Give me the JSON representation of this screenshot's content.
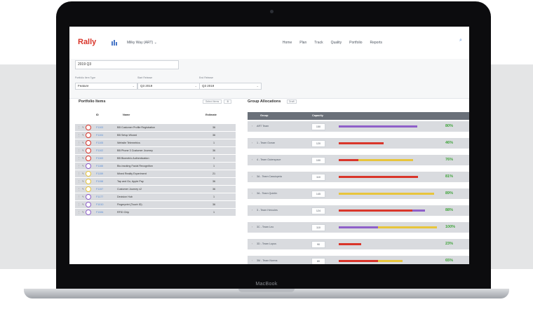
{
  "device": {
    "brand": "MacBook"
  },
  "app": {
    "logo": "Rally",
    "workspace": "Milky Way (ART) ⌄",
    "nav": [
      "Home",
      "Plan",
      "Track",
      "Quality",
      "Portfolio",
      "Reports"
    ]
  },
  "filters": {
    "title": "2019 Q3",
    "item_type_label": "Portfolio Item Type",
    "item_type_value": "Feature",
    "start_label": "Start Release",
    "start_value": "Q3 2019",
    "end_label": "End Release",
    "end_value": "Q3 2019"
  },
  "portfolio": {
    "title": "Portfolio Items",
    "tools": [
      "Select Items",
      "⚙"
    ],
    "columns": {
      "id": "ID",
      "name": "Name",
      "estimate": "Estimate"
    },
    "rows": [
      {
        "id": "F1103",
        "name": "BB Customer Profile Registration",
        "estimate": "36",
        "color": "#d9352a"
      },
      {
        "id": "F1104",
        "name": "BB Setup Wizard",
        "estimate": "36",
        "color": "#d9352a"
      },
      {
        "id": "F1105",
        "name": "Website Telemetrics",
        "estimate": "1",
        "color": "#d9352a"
      },
      {
        "id": "F1102",
        "name": "BB Phone 3 Customer Journey",
        "estimate": "36",
        "color": "#d9352a"
      },
      {
        "id": "F1163",
        "name": "BB Biometric Authentication",
        "estimate": "3",
        "color": "#d9352a"
      },
      {
        "id": "F1166",
        "name": "Bio-tracking Facial Recognition",
        "estimate": "1",
        "color": "#8e5fc9"
      },
      {
        "id": "F1159",
        "name": "Mixed Reality Experiment",
        "estimate": "21",
        "color": "#e8c53c"
      },
      {
        "id": "F1158",
        "name": "Tap and Go, Apple Pay",
        "estimate": "36",
        "color": "#e8c53c"
      },
      {
        "id": "F1157",
        "name": "Customer Journey v2",
        "estimate": "36",
        "color": "#e8c53c"
      },
      {
        "id": "F1177",
        "name": "Decision Hub",
        "estimate": "1",
        "color": "#8e5fc9"
      },
      {
        "id": "F1010",
        "name": "Fingerprint (Touch ID)",
        "estimate": "36",
        "color": "#8e5fc9"
      },
      {
        "id": "F1084",
        "name": "RFID Chip",
        "estimate": "1",
        "color": "#8e5fc9"
      }
    ]
  },
  "allocations": {
    "title": "Group Allocations",
    "badge": "Draft",
    "columns": {
      "group": "Group",
      "capacity": "Capacity"
    },
    "rows": [
      {
        "group": "ART Team",
        "capacity": "150",
        "percent": "80%",
        "segments": [
          {
            "color": "#8e5fc9",
            "fraction": 0.8
          }
        ]
      },
      {
        "group": "1 - Team Ocean",
        "capacity": "120",
        "percent": "46%",
        "segments": [
          {
            "color": "#d9352a",
            "fraction": 0.46
          }
        ]
      },
      {
        "group": "4 - Team Outerspace",
        "capacity": "100",
        "percent": "76%",
        "segments": [
          {
            "color": "#d9352a",
            "fraction": 0.2
          },
          {
            "color": "#e8c53c",
            "fraction": 0.56
          }
        ]
      },
      {
        "group": "3A - Team Cassiopeia",
        "capacity": "110",
        "percent": "81%",
        "segments": [
          {
            "color": "#d9352a",
            "fraction": 0.81
          }
        ]
      },
      {
        "group": "3A - Team Quintin",
        "capacity": "145",
        "percent": "89%",
        "segments": [
          {
            "color": "#e8c53c",
            "fraction": 0.97
          }
        ]
      },
      {
        "group": "3 - Team Hercules",
        "capacity": "124",
        "percent": "88%",
        "segments": [
          {
            "color": "#d9352a",
            "fraction": 0.75
          },
          {
            "color": "#8e5fc9",
            "fraction": 0.13
          }
        ]
      },
      {
        "group": "3C - Team Leo",
        "capacity": "110",
        "percent": "100%",
        "segments": [
          {
            "color": "#8e5fc9",
            "fraction": 0.4
          },
          {
            "color": "#e8c53c",
            "fraction": 0.6
          }
        ]
      },
      {
        "group": "3D - Team Lupus",
        "capacity": "90",
        "percent": "23%",
        "segments": [
          {
            "color": "#d9352a",
            "fraction": 0.23
          }
        ]
      },
      {
        "group": "3M - Team Norma",
        "capacity": "80",
        "percent": "65%",
        "segments": [
          {
            "color": "#d9352a",
            "fraction": 0.4
          },
          {
            "color": "#e8c53c",
            "fraction": 0.25
          }
        ]
      }
    ]
  }
}
